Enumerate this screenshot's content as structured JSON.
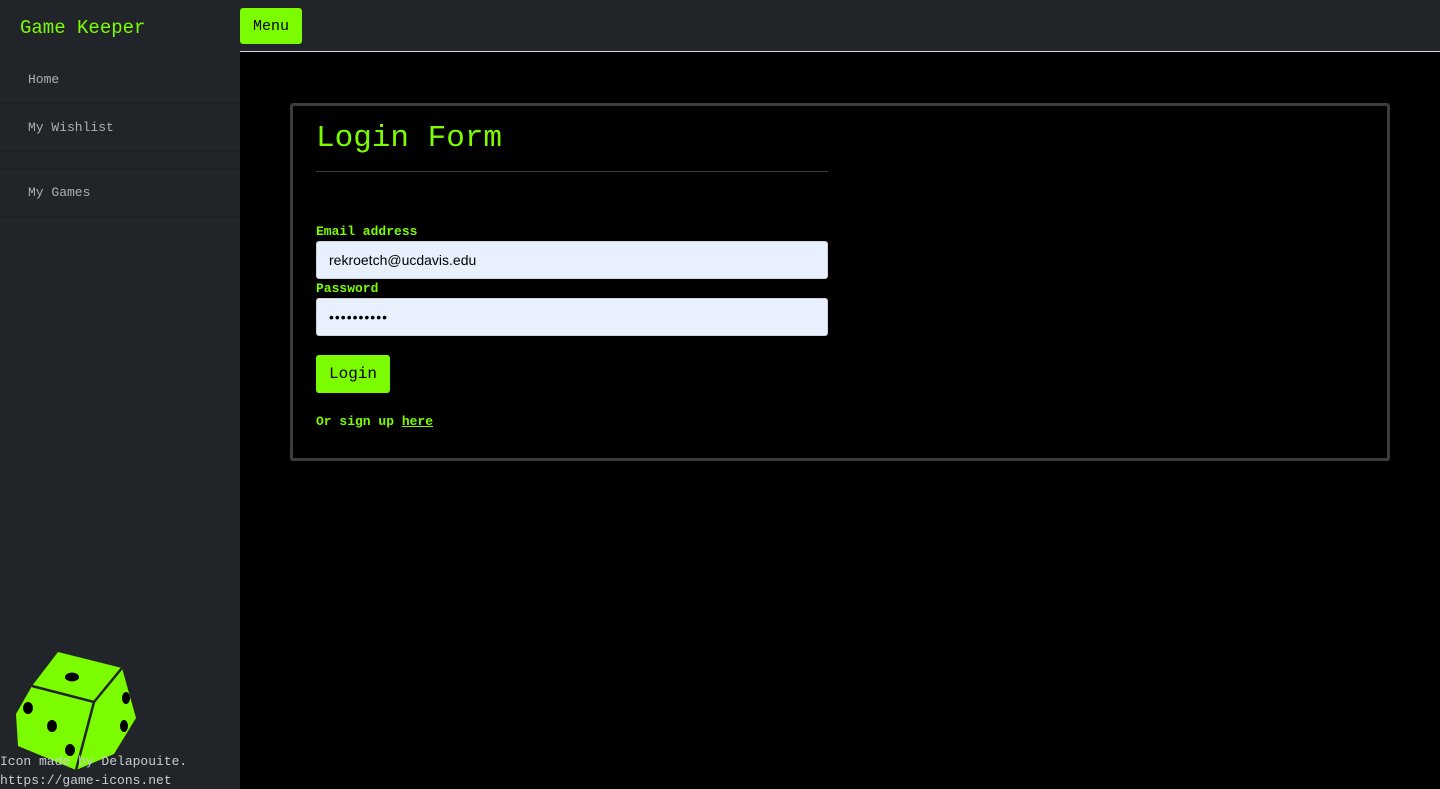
{
  "sidebar": {
    "brand": "Game Keeper",
    "items": [
      {
        "label": "Home"
      },
      {
        "label": "My Wishlist"
      },
      {
        "label": "My Games"
      }
    ],
    "credit_line1": "Icon made by Delapouite.",
    "credit_line2": "https://game-icons.net"
  },
  "topbar": {
    "menu_label": "Menu"
  },
  "form": {
    "title": "Login Form",
    "email_label": "Email address",
    "email_value": "rekroetch@ucdavis.edu",
    "password_label": "Password",
    "password_value": "••••••••••",
    "login_label": "Login",
    "signup_prefix": "Or sign up ",
    "signup_link": "here"
  },
  "colors": {
    "accent": "#7cfc00",
    "sidebar_bg": "#212529",
    "page_bg": "#000000",
    "input_bg": "#e8f0fe"
  },
  "icons": {
    "logo": "dice-icon"
  }
}
